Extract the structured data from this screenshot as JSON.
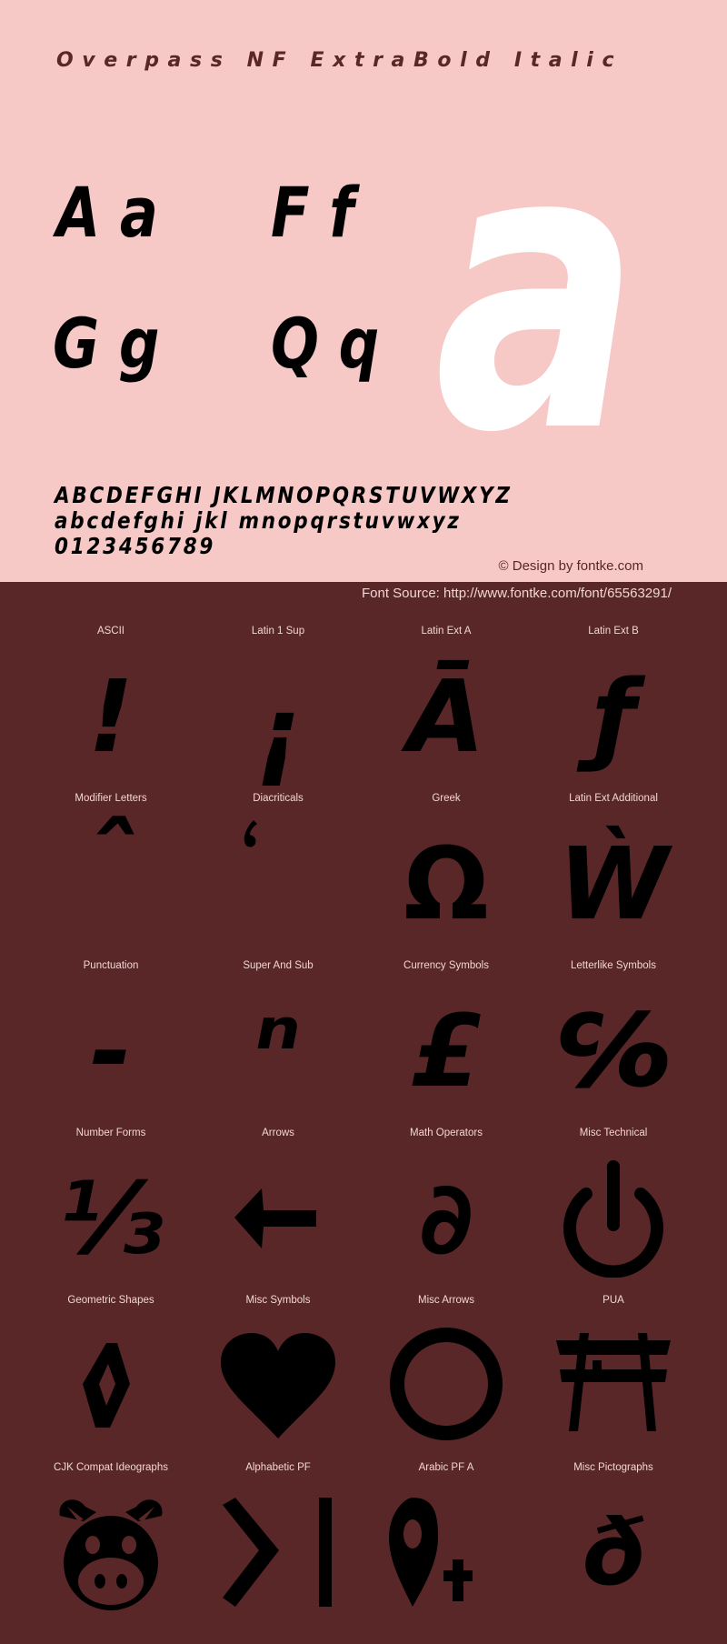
{
  "header": {
    "font_name": "Overpass NF ExtraBold Italic"
  },
  "preview": {
    "pairs": [
      "A a",
      "F f",
      "G g",
      "Q q"
    ],
    "big_letter": "a"
  },
  "charset": {
    "uppercase": "ABCDEFGHI JKLMNOPQRSTUVWXYZ",
    "lowercase": "abcdefghi jkl mnopqrstuvwxyz",
    "digits": "0123456789"
  },
  "credit": "© Design by fontke.com",
  "source": "Font Source: http://www.fontke.com/font/65563291/",
  "colors": {
    "top_background": "#f6c8c6",
    "bottom_background": "#5a2728",
    "title_text": "#5a2728",
    "glyph": "#000000",
    "big_letter": "#ffffff",
    "label_text": "#f0d6d4"
  },
  "blocks": [
    {
      "label": "ASCII",
      "glyph": "!"
    },
    {
      "label": "Latin 1 Sup",
      "glyph": "¡"
    },
    {
      "label": "Latin Ext A",
      "glyph": "Ā"
    },
    {
      "label": "Latin Ext B",
      "glyph": "ƒ"
    },
    {
      "label": "Modifier Letters",
      "glyph": "ˆ"
    },
    {
      "label": "Diacriticals",
      "glyph": "̒"
    },
    {
      "label": "Greek",
      "glyph": "Ω"
    },
    {
      "label": "Latin Ext Additional",
      "glyph": "Ẁ"
    },
    {
      "label": "Punctuation",
      "glyph": "‐"
    },
    {
      "label": "Super And Sub",
      "glyph": "ⁿ"
    },
    {
      "label": "Currency Symbols",
      "glyph": "£"
    },
    {
      "label": "Letterlike Symbols",
      "glyph": "℅"
    },
    {
      "label": "Number Forms",
      "glyph": "⅓"
    },
    {
      "label": "Arrows",
      "glyph": "←"
    },
    {
      "label": "Math Operators",
      "glyph": "∂"
    },
    {
      "label": "Misc Technical",
      "glyph": "power-icon"
    },
    {
      "label": "Geometric Shapes",
      "glyph": "◊"
    },
    {
      "label": "Misc Symbols",
      "glyph": "heart-icon"
    },
    {
      "label": "Misc Arrows",
      "glyph": "circle-icon"
    },
    {
      "label": "PUA",
      "glyph": "torii-gate-icon"
    },
    {
      "label": "CJK Compat Ideographs",
      "glyph": "pig-face-icon"
    },
    {
      "label": "Alphabetic PF",
      "glyph": "chevron-bar-icon"
    },
    {
      "label": "Arabic PF A",
      "glyph": "map-pin-plus-icon"
    },
    {
      "label": "Misc Pictographs",
      "glyph": "ð"
    }
  ]
}
